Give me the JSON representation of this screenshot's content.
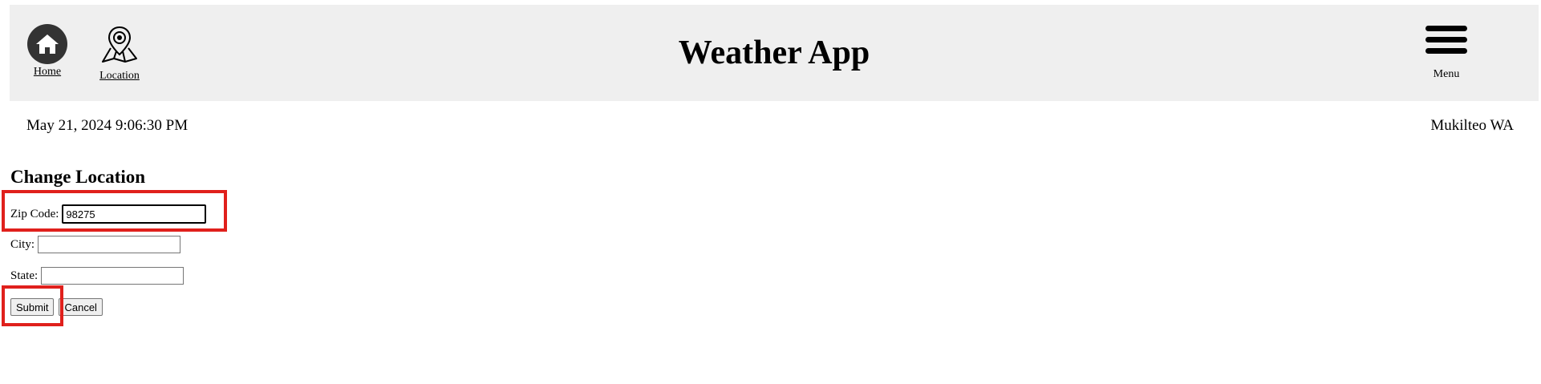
{
  "header": {
    "title": "Weather App",
    "nav": {
      "home_label": "Home",
      "location_label": "Location"
    },
    "menu_label": "Menu"
  },
  "info": {
    "datetime": "May 21, 2024 9:06:30 PM",
    "location": "Mukilteo WA"
  },
  "form": {
    "title": "Change Location",
    "zip_label": "Zip Code:",
    "zip_value": "98275",
    "city_label": "City:",
    "city_value": "",
    "state_label": "State:",
    "state_value": "",
    "submit_label": "Submit",
    "cancel_label": "Cancel"
  },
  "colors": {
    "header_bg": "#efefef",
    "highlight": "#e0201c",
    "home_icon_bg": "#333333"
  },
  "icons": {
    "home": "home-icon",
    "location": "map-pin-icon",
    "menu": "hamburger-menu-icon"
  }
}
